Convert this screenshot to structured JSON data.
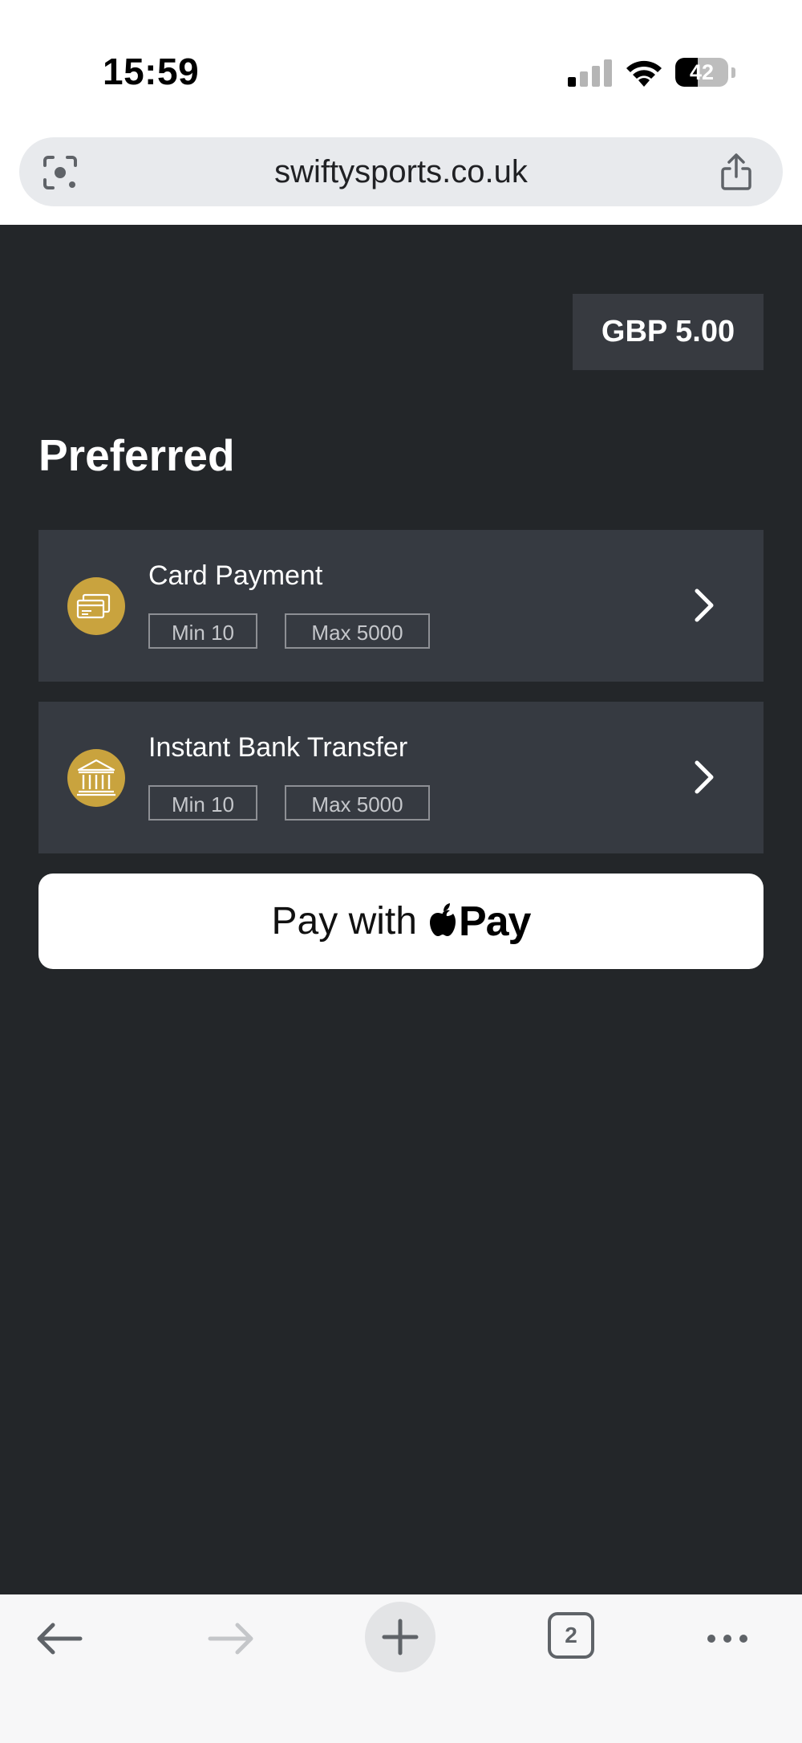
{
  "status_bar": {
    "time": "15:59",
    "battery_percent": "42",
    "battery_level": 0.42
  },
  "browser": {
    "url": "swiftysports.co.uk",
    "open_tabs": "2"
  },
  "payment": {
    "amount": "GBP 5.00",
    "section_title": "Preferred",
    "methods": [
      {
        "name": "Card Payment",
        "min": "Min 10",
        "max": "Max 5000",
        "icon": "card-payment-icon"
      },
      {
        "name": "Instant Bank Transfer",
        "min": "Min 10",
        "max": "Max 5000",
        "icon": "bank-icon"
      }
    ],
    "apple_pay": {
      "label": "Pay with",
      "brand": "Pay"
    }
  },
  "colors": {
    "page_background": "#232629",
    "row_background": "#363a41",
    "accent_gold": "#c9a33e"
  }
}
